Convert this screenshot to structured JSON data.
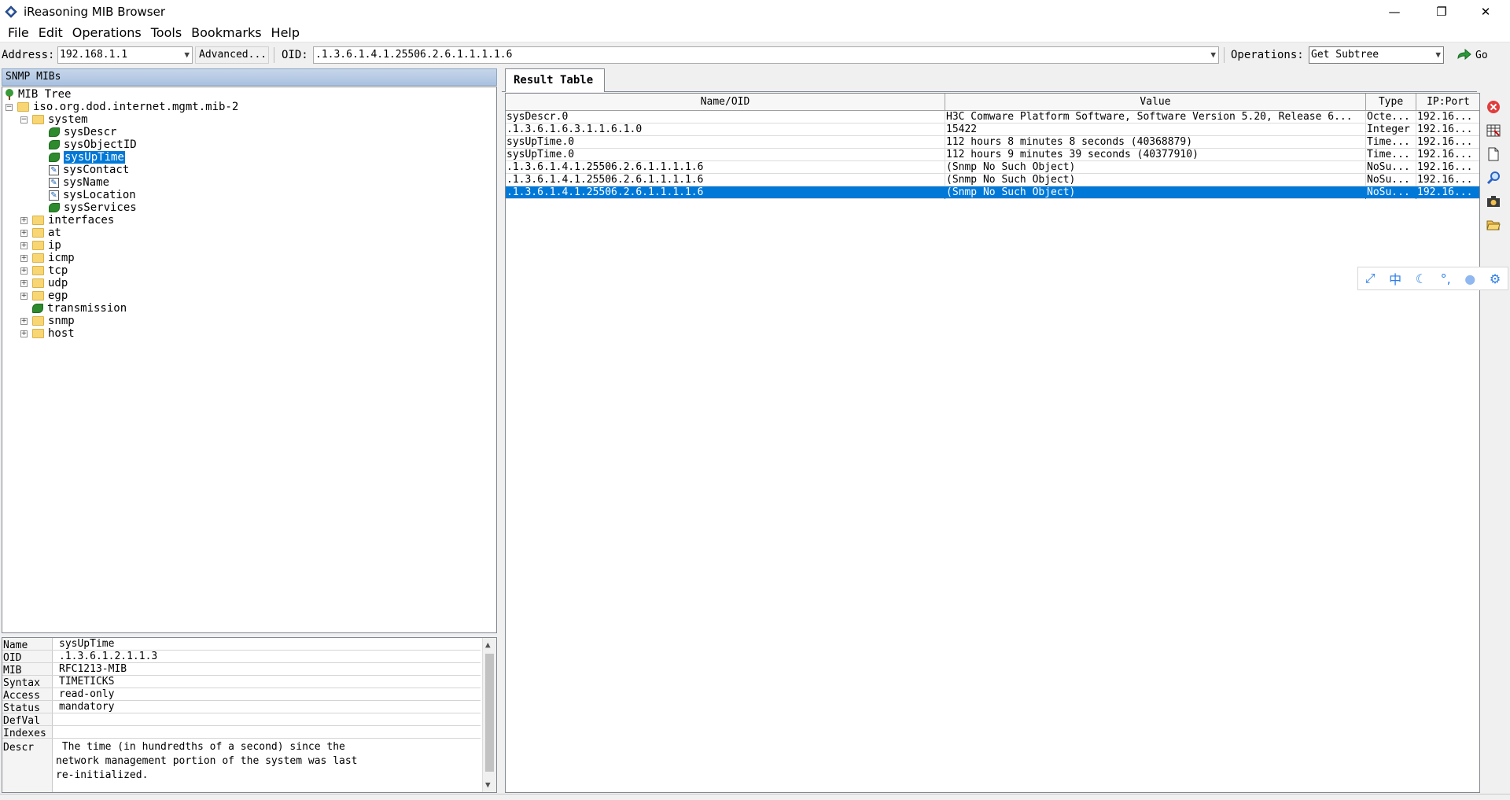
{
  "window": {
    "title": "iReasoning MIB Browser",
    "minimize": "—",
    "restore": "❐",
    "close": "✕"
  },
  "menu": [
    "File",
    "Edit",
    "Operations",
    "Tools",
    "Bookmarks",
    "Help"
  ],
  "toolbar": {
    "address_label": "Address:",
    "address_value": "192.168.1.1",
    "advanced_label": "Advanced...",
    "oid_label": "OID:",
    "oid_value": ".1.3.6.1.4.1.25506.2.6.1.1.1.1.6",
    "operations_label": "Operations:",
    "operations_value": "Get Subtree",
    "go_label": "Go"
  },
  "left": {
    "header": "SNMP MIBs",
    "tree": {
      "root": "MIB Tree",
      "mib2": "iso.org.dod.internet.mgmt.mib-2",
      "system": "system",
      "sysDescr": "sysDescr",
      "sysObjectID": "sysObjectID",
      "sysUpTime": "sysUpTime",
      "sysContact": "sysContact",
      "sysName": "sysName",
      "sysLocation": "sysLocation",
      "sysServices": "sysServices",
      "interfaces": "interfaces",
      "at": "at",
      "ip": "ip",
      "icmp": "icmp",
      "tcp": "tcp",
      "udp": "udp",
      "egp": "egp",
      "transmission": "transmission",
      "snmp": "snmp",
      "host": "host"
    }
  },
  "props": {
    "name_key": "Name",
    "name_val": "sysUpTime",
    "oid_key": "OID",
    "oid_val": ".1.3.6.1.2.1.1.3",
    "mib_key": "MIB",
    "mib_val": "RFC1213-MIB",
    "syntax_key": "Syntax",
    "syntax_val": "TIMETICKS",
    "access_key": "Access",
    "access_val": "read-only",
    "status_key": "Status",
    "status_val": "mandatory",
    "defval_key": "DefVal",
    "defval_val": "",
    "indexes_key": "Indexes",
    "indexes_val": "",
    "descr_key": "Descr",
    "descr_val": " The time (in hundredths of a second) since the\nnetwork management portion of the system was last\nre-initialized."
  },
  "result": {
    "tab": "Result Table",
    "columns": {
      "name": "Name/OID",
      "value": "Value",
      "type": "Type",
      "ipport": "IP:Port"
    },
    "rows": [
      {
        "name": "sysDescr.0",
        "value": "H3C Comware Platform Software, Software Version 5.20, Release 6...",
        "type": "Octe...",
        "ip": "192.16..."
      },
      {
        "name": ".1.3.6.1.6.3.1.1.6.1.0",
        "value": "15422",
        "type": "Integer",
        "ip": "192.16..."
      },
      {
        "name": "sysUpTime.0",
        "value": "112 hours 8 minutes 8 seconds (40368879)",
        "type": "Time...",
        "ip": "192.16..."
      },
      {
        "name": "sysUpTime.0",
        "value": "112 hours 9 minutes 39 seconds (40377910)",
        "type": "Time...",
        "ip": "192.16..."
      },
      {
        "name": ".1.3.6.1.4.1.25506.2.6.1.1.1.1.6",
        "value": "(Snmp No Such Object)",
        "type": "NoSu...",
        "ip": "192.16..."
      },
      {
        "name": ".1.3.6.1.4.1.25506.2.6.1.1.1.1.6",
        "value": "(Snmp No Such Object)",
        "type": "NoSu...",
        "ip": "192.16..."
      },
      {
        "name": ".1.3.6.1.4.1.25506.2.6.1.1.1.1.6",
        "value": "(Snmp No Such Object)",
        "type": "NoSu...",
        "ip": "192.16..."
      }
    ]
  },
  "ime": {
    "chinese": "中"
  },
  "icons": {
    "app": "app-diamond-icon",
    "go": "go-arrow-icon",
    "tree_root": "tree-icon",
    "side_tools": [
      "stop-icon",
      "table-export-icon",
      "document-icon",
      "search-icon",
      "camera-icon",
      "open-folder-icon"
    ]
  },
  "colors": {
    "selection": "#0078d7",
    "header_gradient_top": "#c6d6ea",
    "header_gradient_bottom": "#a9c1df",
    "folder": "#f7d673",
    "leaf": "#2d8a2d",
    "stop_icon": "#e23c3c"
  }
}
